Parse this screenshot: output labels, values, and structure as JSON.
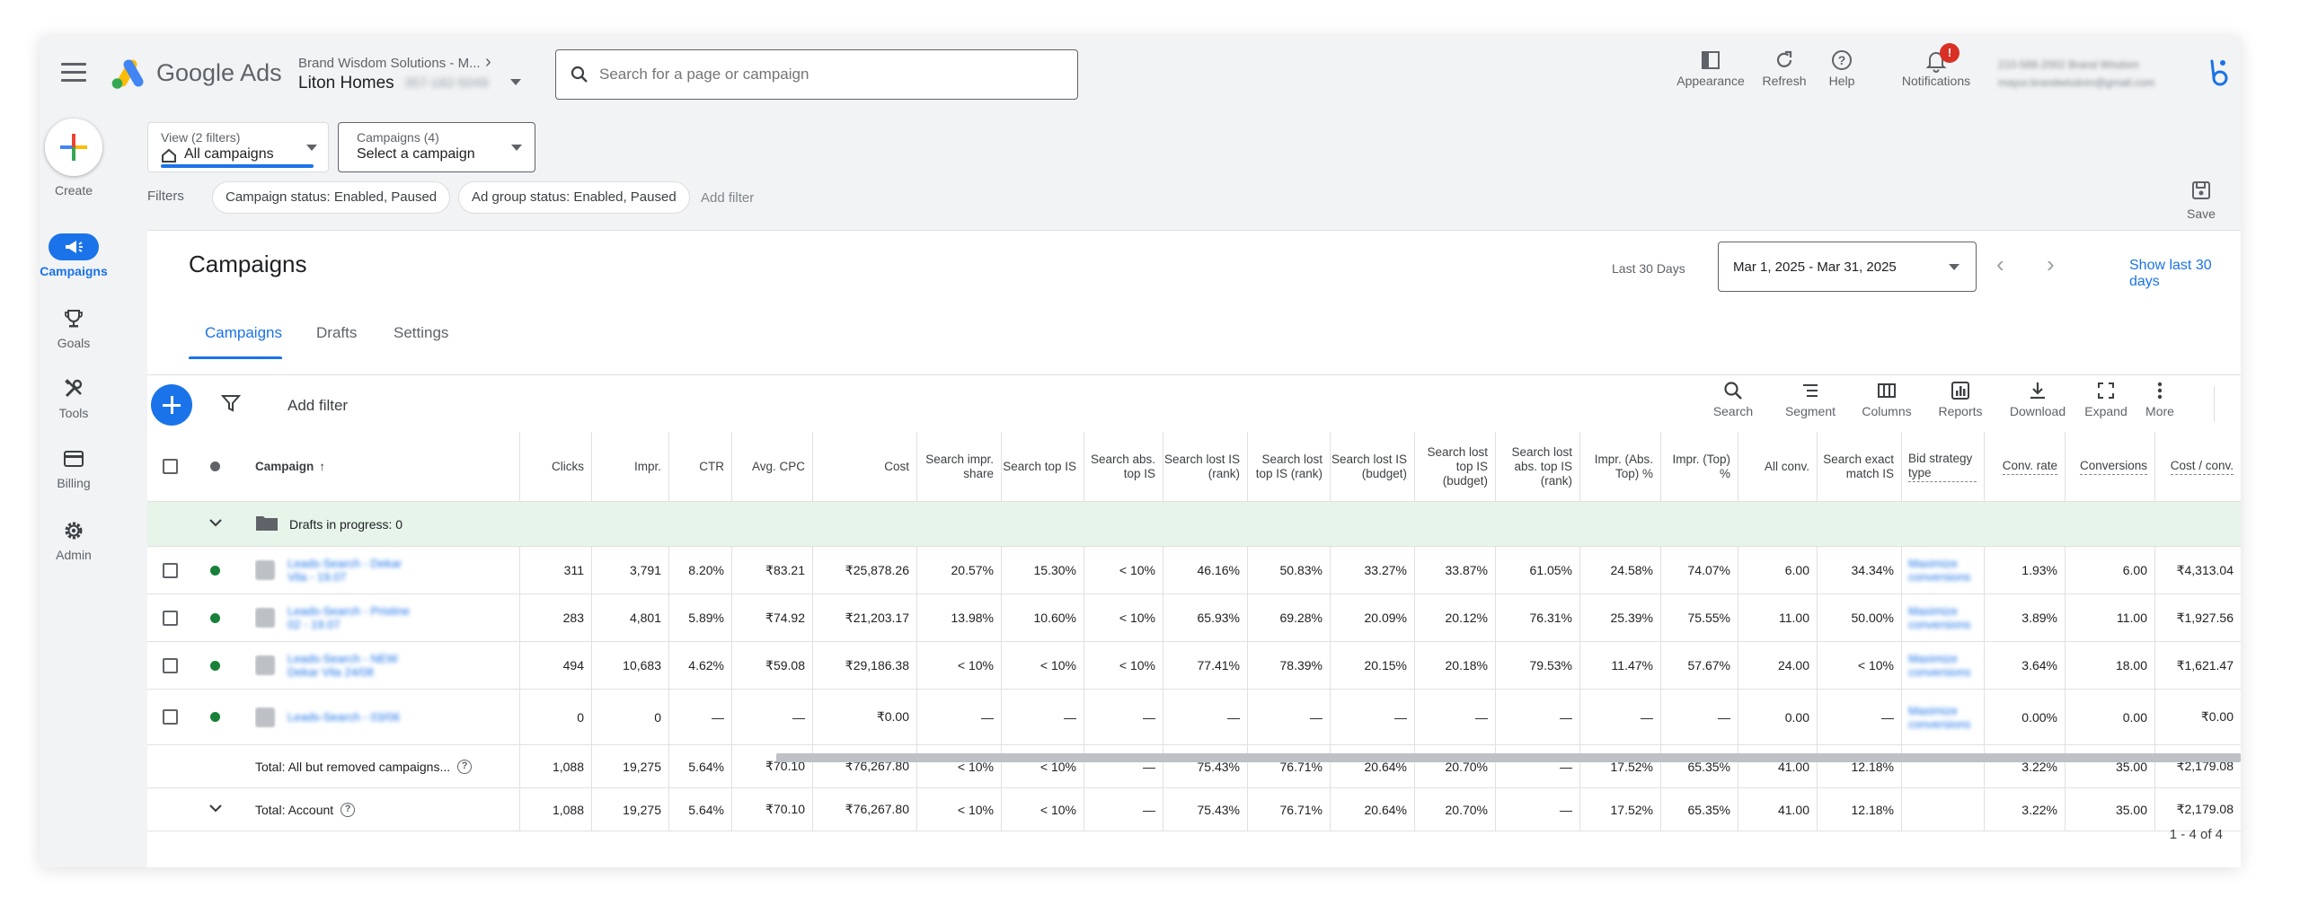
{
  "header": {
    "brand": "Google Ads",
    "account_sub": "Brand Wisdom Solutions - M...",
    "account_name": "Liton Homes",
    "account_id": "357-182-5049",
    "search_placeholder": "Search for a page or campaign",
    "tools": {
      "appearance": "Appearance",
      "refresh": "Refresh",
      "help": "Help",
      "notifications": "Notifications"
    },
    "notification_count": "!",
    "user_line1": "210-566-2002 Brand Wisdom",
    "user_line2": "mayur.brandwisdom@gmail.com"
  },
  "nav": {
    "create": "Create",
    "campaigns": "Campaigns",
    "goals": "Goals",
    "tools": "Tools",
    "billing": "Billing",
    "admin": "Admin"
  },
  "view": {
    "label": "View (2 filters)",
    "value": "All campaigns"
  },
  "campaign_select": {
    "label": "Campaigns (4)",
    "value": "Select a campaign"
  },
  "filters": {
    "label": "Filters",
    "chips": [
      "Campaign status: Enabled, Paused",
      "Ad group status: Enabled, Paused"
    ],
    "add": "Add filter"
  },
  "save": "Save",
  "page_title": "Campaigns",
  "date": {
    "label": "Last 30 Days",
    "range": "Mar 1, 2025 - Mar 31, 2025",
    "show_last": "Show last 30 days"
  },
  "tabs": [
    "Campaigns",
    "Drafts",
    "Settings"
  ],
  "toolbar": {
    "add_filter": "Add filter",
    "buttons": [
      "Search",
      "Segment",
      "Columns",
      "Reports",
      "Download",
      "Expand",
      "More"
    ]
  },
  "table": {
    "headers": {
      "campaign": "Campaign",
      "clicks": "Clicks",
      "impr": "Impr.",
      "ctr": "CTR",
      "avg_cpc": "Avg. CPC",
      "cost": "Cost",
      "search_impr_share": "Search impr. share",
      "search_top_is": "Search top IS",
      "search_abs_top_is": "Search abs. top IS",
      "search_lost_is_rank": "Search lost IS (rank)",
      "search_lost_top_is_rank": "Search lost top IS (rank)",
      "search_lost_is_budget": "Search lost IS (budget)",
      "search_lost_top_is_budget": "Search lost top IS (budget)",
      "search_lost_abs_top_is_rank": "Search lost abs. top IS (rank)",
      "impr_abs_top": "Impr. (Abs. Top) %",
      "impr_top": "Impr. (Top) %",
      "all_conv": "All conv.",
      "search_exact_match_is": "Search exact match IS",
      "bid_strategy_type": "Bid strategy type",
      "conv_rate": "Conv. rate",
      "conversions": "Conversions",
      "cost_per_conv": "Cost / conv."
    },
    "draft_row": "Drafts in progress: 0",
    "rows": [
      {
        "name": "Leads-Search - Dekar Vila - 19.07",
        "bid": "Maximize conversions",
        "values": [
          "311",
          "3,791",
          "8.20%",
          "₹83.21",
          "₹25,878.26",
          "20.57%",
          "15.30%",
          "< 10%",
          "46.16%",
          "50.83%",
          "33.27%",
          "33.87%",
          "61.05%",
          "24.58%",
          "74.07%",
          "6.00",
          "34.34%",
          "1.93%",
          "6.00",
          "₹4,313.04"
        ]
      },
      {
        "name": "Leads-Search - Pristine 02 - 19.07",
        "bid": "Maximize conversions",
        "values": [
          "283",
          "4,801",
          "5.89%",
          "₹74.92",
          "₹21,203.17",
          "13.98%",
          "10.60%",
          "< 10%",
          "65.93%",
          "69.28%",
          "20.09%",
          "20.12%",
          "76.31%",
          "25.39%",
          "75.55%",
          "11.00",
          "50.00%",
          "3.89%",
          "11.00",
          "₹1,927.56"
        ]
      },
      {
        "name": "Leads-Search - NEW Dekar Vila 24/08",
        "bid": "Maximize conversions",
        "values": [
          "494",
          "10,683",
          "4.62%",
          "₹59.08",
          "₹29,186.38",
          "< 10%",
          "< 10%",
          "< 10%",
          "77.41%",
          "78.39%",
          "20.15%",
          "20.18%",
          "79.53%",
          "11.47%",
          "57.67%",
          "24.00",
          "< 10%",
          "3.64%",
          "18.00",
          "₹1,621.47"
        ]
      },
      {
        "name": "Leads-Search - 03/06",
        "bid": "Maximize conversions",
        "values": [
          "0",
          "0",
          "—",
          "—",
          "₹0.00",
          "—",
          "—",
          "—",
          "—",
          "—",
          "—",
          "—",
          "—",
          "—",
          "—",
          "0.00",
          "—",
          "0.00%",
          "0.00",
          "₹0.00"
        ]
      }
    ],
    "totals": [
      {
        "label": "Total: All but removed campaigns...",
        "values": [
          "1,088",
          "19,275",
          "5.64%",
          "₹70.10",
          "₹76,267.80",
          "< 10%",
          "< 10%",
          "—",
          "75.43%",
          "76.71%",
          "20.64%",
          "20.70%",
          "—",
          "17.52%",
          "65.35%",
          "41.00",
          "12.18%",
          "3.22%",
          "35.00",
          "₹2,179.08"
        ]
      },
      {
        "label": "Total: Account",
        "values": [
          "1,088",
          "19,275",
          "5.64%",
          "₹70.10",
          "₹76,267.80",
          "< 10%",
          "< 10%",
          "—",
          "75.43%",
          "76.71%",
          "20.64%",
          "20.70%",
          "—",
          "17.52%",
          "65.35%",
          "41.00",
          "12.18%",
          "3.22%",
          "35.00",
          "₹2,179.08"
        ]
      }
    ]
  },
  "pagination": "1 - 4 of 4",
  "colors": {
    "accent": "#1a73e8",
    "enabled": "#188038",
    "draft_bg": "#e6f4ea"
  }
}
